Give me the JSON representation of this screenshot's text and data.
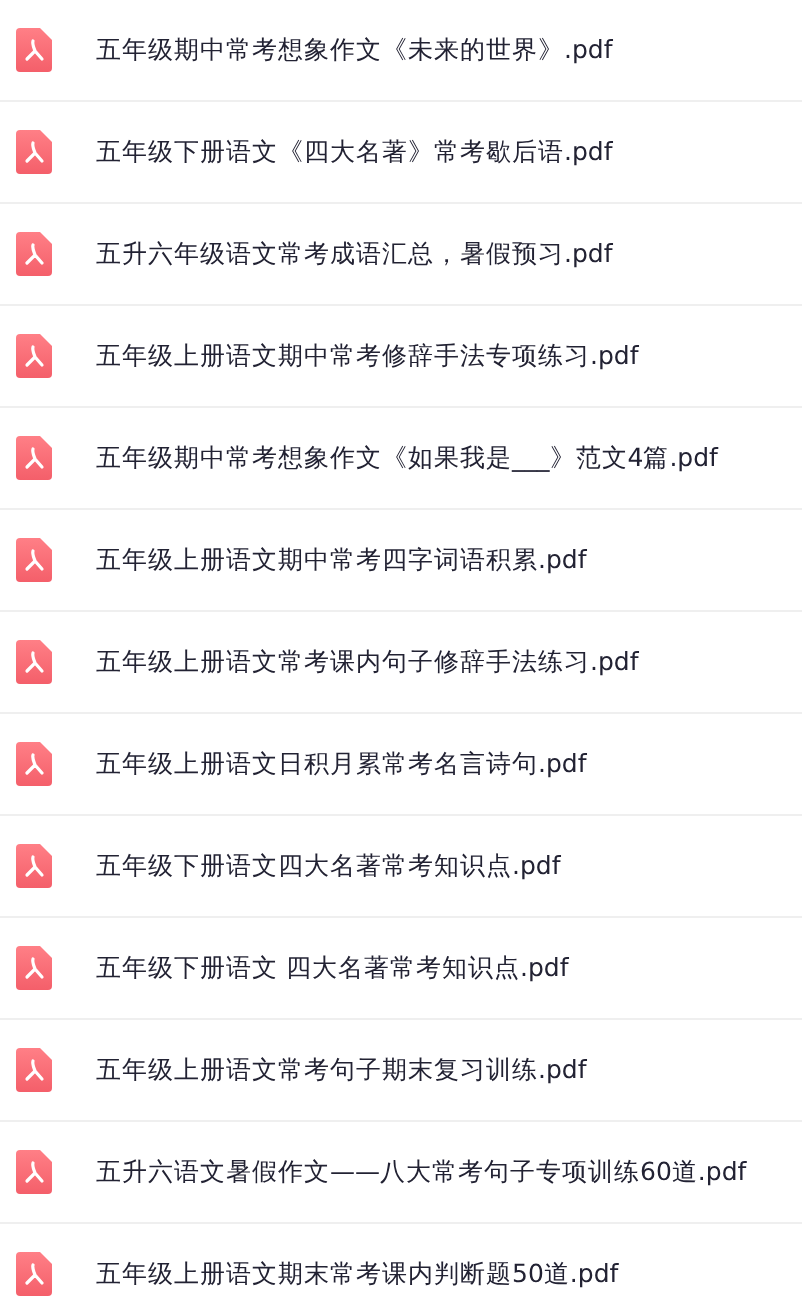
{
  "files": [
    {
      "name": "五年级期中常考想象作文《未来的世界》.pdf"
    },
    {
      "name": "五年级下册语文《四大名著》常考歇后语.pdf"
    },
    {
      "name": "五升六年级语文常考成语汇总，暑假预习.pdf"
    },
    {
      "name": "五年级上册语文期中常考修辞手法专项练习.pdf"
    },
    {
      "name": "五年级期中常考想象作文《如果我是___》范文4篇.pdf"
    },
    {
      "name": "五年级上册语文期中常考四字词语积累.pdf"
    },
    {
      "name": "五年级上册语文常考课内句子修辞手法练习.pdf"
    },
    {
      "name": "五年级上册语文日积月累常考名言诗句.pdf"
    },
    {
      "name": "五年级下册语文四大名著常考知识点.pdf"
    },
    {
      "name": "五年级下册语文 四大名著常考知识点.pdf"
    },
    {
      "name": "五年级上册语文常考句子期末复习训练.pdf"
    },
    {
      "name": "五升六语文暑假作文——八大常考句子专项训练60道.pdf"
    },
    {
      "name": "五年级上册语文期末常考课内判断题50道.pdf"
    }
  ]
}
